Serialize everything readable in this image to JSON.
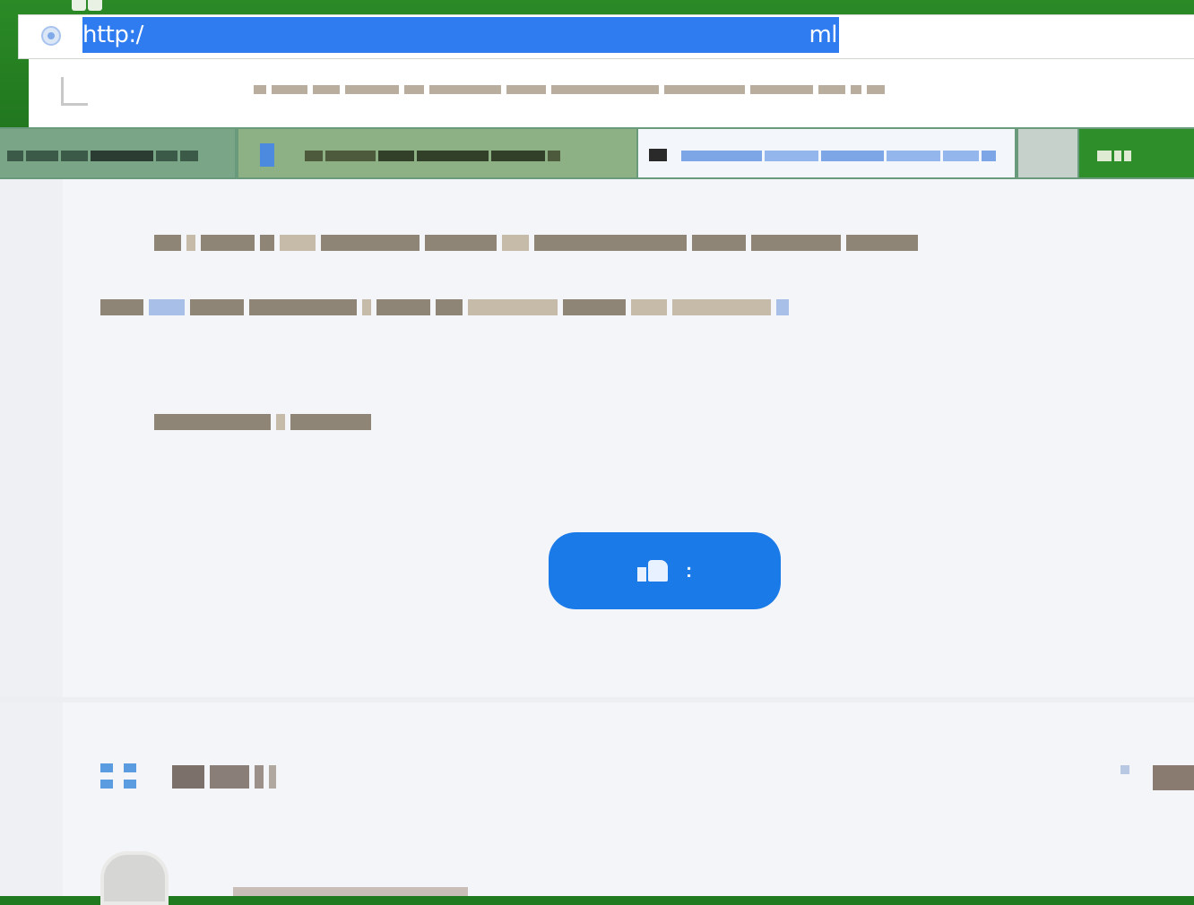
{
  "browser": {
    "top_tabs": [
      "",
      ""
    ],
    "address_bar": {
      "url_prefix": "http:/",
      "url_suffix": "ml"
    },
    "page_title": "",
    "tabs": [
      {
        "label": ""
      },
      {
        "label": ""
      },
      {
        "label": "",
        "active": true
      },
      {
        "label": ""
      },
      {
        "label": ""
      }
    ]
  },
  "article": {
    "paragraphs": [
      "",
      "",
      ""
    ],
    "like_button": {
      "count": ":"
    }
  },
  "comments": {
    "title": ""
  },
  "colors": {
    "accent": "#1a7ae8",
    "chrome_green": "#2b8a26",
    "url_selection": "#2f7bf0",
    "page_bg": "#f4f5f8"
  },
  "icons": {
    "address": "site-info-icon",
    "title": "page-icon",
    "like": "thumbs-up-icon",
    "comment": "comment-icon",
    "avatar": "avatar-icon"
  }
}
